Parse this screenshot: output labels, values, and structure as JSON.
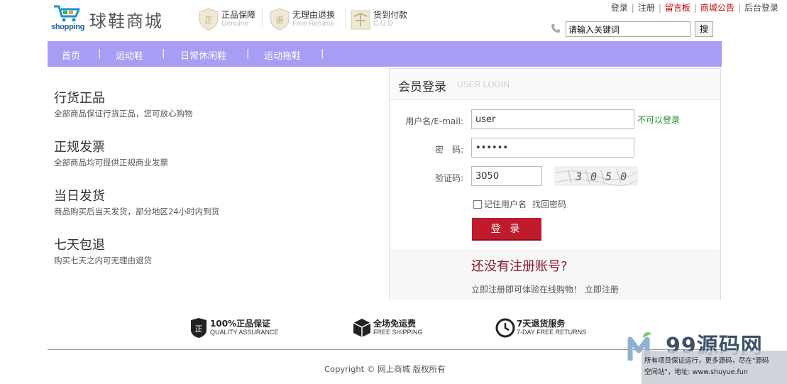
{
  "header": {
    "logo_text": "shopping",
    "site_name": "球鞋商城",
    "features": [
      {
        "title": "正品保障",
        "subtitle": "Genuine"
      },
      {
        "title": "无理由退换",
        "subtitle": "Free Returns"
      },
      {
        "title": "货到付款",
        "subtitle": "C.O.D"
      }
    ],
    "top_links": [
      "登录",
      "注册",
      "留言板",
      "商城公告",
      "后台登录"
    ],
    "search": {
      "value": "请输入关键词",
      "button": "搜"
    }
  },
  "nav": {
    "items": [
      "首页",
      "运动鞋",
      "日常休闲鞋",
      "运动拖鞋"
    ]
  },
  "left_features": [
    {
      "title": "行货正品",
      "desc": "全部商品保证行货正品，您可放心购物"
    },
    {
      "title": "正规发票",
      "desc": "全部商品均可提供正规商业发票"
    },
    {
      "title": "当日发货",
      "desc": "商品购买后当天发货，部分地区24小时内到货"
    },
    {
      "title": "七天包退",
      "desc": "购买七天之内可无理由退货"
    }
  ],
  "login": {
    "title": "会员登录",
    "subtitle": "USER LOGIN",
    "username_label": "用户名/E-mail:",
    "username_value": "user",
    "username_hint": "不可以登录",
    "password_label": "密　码:",
    "password_value": "••••••",
    "captcha_label": "验证码:",
    "captcha_value": "3050",
    "captcha_image_text": "3050",
    "remember_label": "记住用户名",
    "forgot_label": "找回密码",
    "login_button": "登 录",
    "register_title": "还没有注册账号?",
    "register_text": "立即注册即可体验在线购物！",
    "register_link": "立即注册"
  },
  "services": [
    {
      "icon": "genuine-shield-icon",
      "title": "100%正品保证",
      "subtitle": "QUALITY ASSURANCE"
    },
    {
      "icon": "box-icon",
      "title": "全场免运费",
      "subtitle": "FREE SHIPPING"
    },
    {
      "icon": "clock-icon",
      "title": "7天退货服务",
      "subtitle": "7-DAY FREE RETURNS"
    }
  ],
  "footer": {
    "copyright": "Copyright © 网上商城 版权所有"
  },
  "watermark": {
    "brand": "99源码网",
    "line1": "所有项目保证运行，更多源码，尽在\"源码",
    "line2": "空间站\"，地址: www.shuyue.fun"
  },
  "colors": {
    "nav": "#a79df5",
    "login_button": "#c11a2c",
    "accent_red": "#c40000",
    "hint_green": "#1f8a1f"
  }
}
